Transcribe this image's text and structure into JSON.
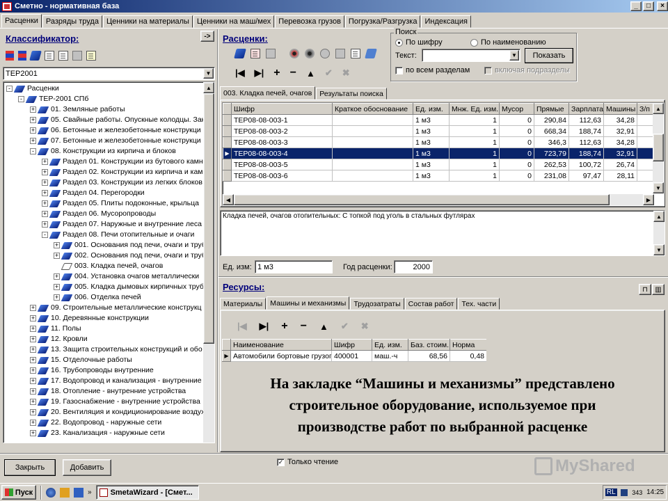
{
  "window": {
    "title": "Сметно - нормативная база"
  },
  "main_tabs": [
    "Расценки",
    "Разряды труда",
    "Ценники на материалы",
    "Ценники на маш/мех",
    "Перевозка грузов",
    "Погрузка/Разгрузка",
    "Индексация"
  ],
  "classifier": {
    "title": "Классификатор:",
    "selected_base": "ТЕР2001",
    "tree": [
      {
        "indent": 0,
        "pm": "-",
        "icon": "book",
        "label": "Расценки"
      },
      {
        "indent": 1,
        "pm": "-",
        "icon": "book",
        "label": "ТЕР-2001 СПб"
      },
      {
        "indent": 2,
        "pm": "+",
        "icon": "book",
        "label": "01. Земляные работы"
      },
      {
        "indent": 2,
        "pm": "+",
        "icon": "book",
        "label": "05. Свайные работы. Опускные колодцы. Зак"
      },
      {
        "indent": 2,
        "pm": "+",
        "icon": "book",
        "label": "06. Бетонные и железобетонные конструкци"
      },
      {
        "indent": 2,
        "pm": "+",
        "icon": "book",
        "label": "07. Бетонные и железобетонные конструкци"
      },
      {
        "indent": 2,
        "pm": "-",
        "icon": "book",
        "label": "08. Конструкции из кирпича и блоков"
      },
      {
        "indent": 3,
        "pm": "+",
        "icon": "book",
        "label": "Раздел 01. Конструкции из бутового камн"
      },
      {
        "indent": 3,
        "pm": "+",
        "icon": "book",
        "label": "Раздел 02. Конструкции из кирпича и кам"
      },
      {
        "indent": 3,
        "pm": "+",
        "icon": "book",
        "label": "Раздел 03. Конструкции из легких блоков"
      },
      {
        "indent": 3,
        "pm": "+",
        "icon": "book",
        "label": "Раздел 04. Перегородки"
      },
      {
        "indent": 3,
        "pm": "+",
        "icon": "book",
        "label": "Раздел 05. Плиты подоконные, крыльца"
      },
      {
        "indent": 3,
        "pm": "+",
        "icon": "book",
        "label": "Раздел 06. Мусоропроводы"
      },
      {
        "indent": 3,
        "pm": "+",
        "icon": "book",
        "label": "Раздел 07. Наружные и внутренние леса"
      },
      {
        "indent": 3,
        "pm": "-",
        "icon": "book",
        "label": "Раздел 08. Печи отопительные и очаги"
      },
      {
        "indent": 4,
        "pm": "+",
        "icon": "book",
        "label": "001. Основания под печи, очаги и труб"
      },
      {
        "indent": 4,
        "pm": "+",
        "icon": "book",
        "label": "002. Основания под печи, очаги и труб"
      },
      {
        "indent": 4,
        "pm": "",
        "icon": "open",
        "label": "003. Кладка печей, очагов"
      },
      {
        "indent": 4,
        "pm": "+",
        "icon": "book",
        "label": "004. Установка очагов металлически"
      },
      {
        "indent": 4,
        "pm": "+",
        "icon": "book",
        "label": "005. Кладка дымовых кирпичных труб"
      },
      {
        "indent": 4,
        "pm": "+",
        "icon": "book",
        "label": "006. Отделка печей"
      },
      {
        "indent": 2,
        "pm": "+",
        "icon": "book",
        "label": "09. Строительные металлические конструкц"
      },
      {
        "indent": 2,
        "pm": "+",
        "icon": "book",
        "label": "10. Деревянные конструкции"
      },
      {
        "indent": 2,
        "pm": "+",
        "icon": "book",
        "label": "11. Полы"
      },
      {
        "indent": 2,
        "pm": "+",
        "icon": "book",
        "label": "12. Кровли"
      },
      {
        "indent": 2,
        "pm": "+",
        "icon": "book",
        "label": "13. Защита строительных конструкций и обо"
      },
      {
        "indent": 2,
        "pm": "+",
        "icon": "book",
        "label": "15. Отделочные работы"
      },
      {
        "indent": 2,
        "pm": "+",
        "icon": "book",
        "label": "16. Трубопроводы внутренние"
      },
      {
        "indent": 2,
        "pm": "+",
        "icon": "book",
        "label": "17. Водопровод и канализация - внутренние у"
      },
      {
        "indent": 2,
        "pm": "+",
        "icon": "book",
        "label": "18. Отопление - внутренние устройства"
      },
      {
        "indent": 2,
        "pm": "+",
        "icon": "book",
        "label": "19. Газоснабжение - внутренние устройства"
      },
      {
        "indent": 2,
        "pm": "+",
        "icon": "book",
        "label": "20. Вентиляция и кондиционирование воздух"
      },
      {
        "indent": 2,
        "pm": "+",
        "icon": "book",
        "label": "22. Водопровод - наружные сети"
      },
      {
        "indent": 2,
        "pm": "+",
        "icon": "book",
        "label": "23. Канализация - наружные сети"
      }
    ]
  },
  "rates": {
    "title": "Расценки:",
    "tabs": [
      "003. Кладка печей, очагов",
      "Результаты поиска"
    ],
    "columns": [
      "Шифр",
      "Краткое обоснование",
      "Ед. изм.",
      "Мнж. Ед. изм.",
      "Мусор",
      "Прямые",
      "Зарплата",
      "Машины",
      "З/п"
    ],
    "rows": [
      [
        "ТЕР08-08-003-1",
        "",
        "1 м3",
        "1",
        "0",
        "290,84",
        "112,63",
        "34,28"
      ],
      [
        "ТЕР08-08-003-2",
        "",
        "1 м3",
        "1",
        "0",
        "668,34",
        "188,74",
        "32,91"
      ],
      [
        "ТЕР08-08-003-3",
        "",
        "1 м3",
        "1",
        "0",
        "346,3",
        "112,63",
        "34,28"
      ],
      [
        "ТЕР08-08-003-4",
        "",
        "1 м3",
        "1",
        "0",
        "723,79",
        "188,74",
        "32,91"
      ],
      [
        "ТЕР08-08-003-5",
        "",
        "1 м3",
        "1",
        "0",
        "262,53",
        "100,72",
        "26,74"
      ],
      [
        "ТЕР08-08-003-6",
        "",
        "1 м3",
        "1",
        "0",
        "231,08",
        "97,47",
        "28,11"
      ]
    ],
    "selected_index": 3,
    "description": "Кладка печей, очагов отопительных: С топкой под уголь в стальных футлярах",
    "unit_label": "Ед. изм:",
    "unit_value": "1 м3",
    "year_label": "Год расценки:",
    "year_value": "2000"
  },
  "search": {
    "group_label": "Поиск",
    "by_code": "По шифру",
    "by_name": "По наименованию",
    "text_label": "Текст:",
    "text_value": "",
    "show_button": "Показать",
    "all_sections": "по всем разделам",
    "include_sub": "включая подразделы"
  },
  "resources": {
    "title": "Ресурсы:",
    "tabs": [
      "Материалы",
      "Машины и механизмы",
      "Трудозатраты",
      "Состав работ",
      "Тех. части"
    ],
    "active_tab": 1,
    "columns": [
      "Наименование",
      "Шифр",
      "Ед. изм.",
      "Баз. стоим.",
      "Норма"
    ],
    "rows": [
      [
        "Автомобили бортовые грузоп",
        "400001",
        "маш.-ч",
        "68,56",
        "0,48"
      ]
    ]
  },
  "overlay": {
    "line1": "На закладке “Машины и механизмы” представлено",
    "line2": "строительное оборудование, используемое при",
    "line3": "производстве работ по выбранной расценке"
  },
  "bottom": {
    "close": "Закрыть",
    "add": "Добавить",
    "read_only": "Только чтение",
    "watermark": "MyShared"
  },
  "taskbar": {
    "start": "Пуск",
    "task": "SmetaWizard - [Смет...",
    "lang": "RL",
    "tray_num": "343",
    "clock": "14:25"
  }
}
